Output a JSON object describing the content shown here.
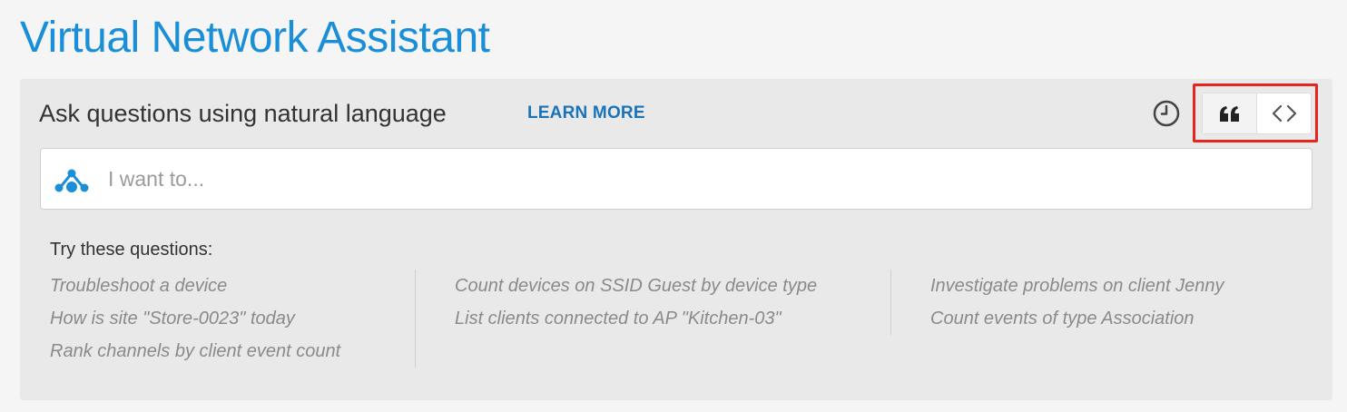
{
  "header": {
    "title": "Virtual Network Assistant"
  },
  "panel": {
    "heading": "Ask questions using natural language",
    "learn_more_label": "LEARN MORE",
    "icons": {
      "history": "clock-history-icon",
      "natural_language_mode": "quote-icon",
      "code_mode": "code-brackets-icon"
    },
    "search": {
      "placeholder": "I want to...",
      "value": ""
    },
    "suggestions_heading": "Try these questions:",
    "suggestion_columns": [
      [
        "Troubleshoot a device",
        "How is site \"Store-0023\" today",
        "Rank channels by client event count"
      ],
      [
        "Count devices on SSID Guest by device type",
        "List clients connected to AP \"Kitchen-03\""
      ],
      [
        "Investigate problems on client Jenny",
        "Count events of type Association"
      ]
    ]
  },
  "colors": {
    "title": "#1a8fd8",
    "link": "#1a73b8",
    "highlight_border": "#e8241f",
    "logo": "#1a8fd8"
  }
}
